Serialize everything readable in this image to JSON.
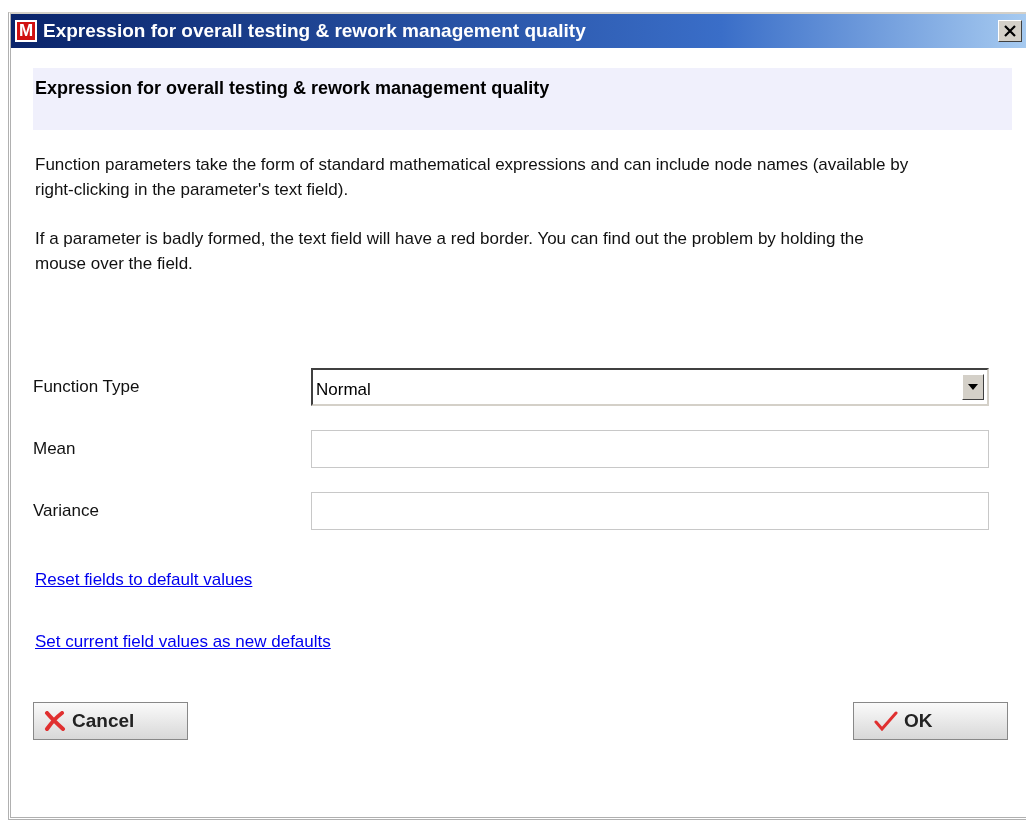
{
  "window": {
    "title": "Expression for overall testing & rework management quality",
    "app_icon_letter": "M"
  },
  "header": "Expression for overall testing & rework management quality",
  "paragraphs": [
    "Function parameters take the form of standard mathematical expressions and can include node names (available by right-clicking in the parameter's text field).",
    "If a parameter is badly formed, the text field will have a red border. You can find out the problem by holding the mouse over the field."
  ],
  "fields": [
    {
      "kind": "dropdown",
      "label": "Function Type",
      "value": "Normal"
    },
    {
      "kind": "text",
      "label": "Mean"
    },
    {
      "kind": "text",
      "label": "Variance"
    }
  ],
  "links": [
    "Reset fields to default values",
    "Set current field values as new defaults"
  ],
  "buttons": [
    {
      "kind": "cancel",
      "label": "Cancel"
    },
    {
      "kind": "ok",
      "label": "OK"
    }
  ]
}
